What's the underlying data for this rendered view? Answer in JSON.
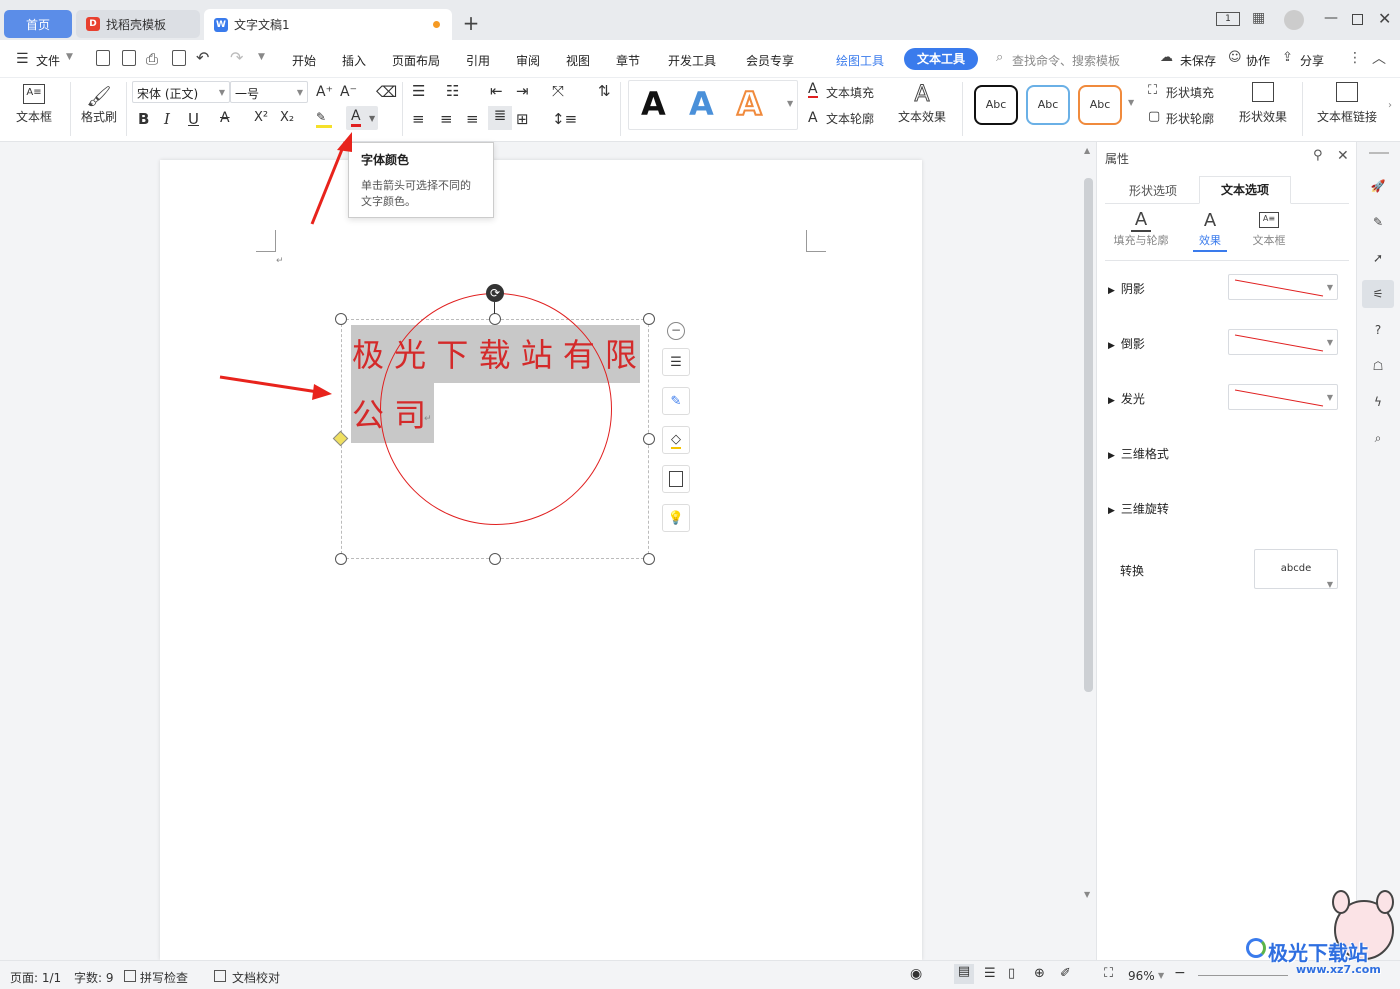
{
  "tabs": {
    "home": "首页",
    "templates": "找稻壳模板",
    "doc": "文字文稿1"
  },
  "menu": {
    "file": "文件",
    "start": "开始",
    "insert": "插入",
    "layout": "页面布局",
    "reference": "引用",
    "review": "审阅",
    "view": "视图",
    "chapter": "章节",
    "devtools": "开发工具",
    "member": "会员专享",
    "drawtools": "绘图工具",
    "texttools": "文本工具",
    "search": "查找命令、搜索模板",
    "unsaved": "未保存",
    "collab": "协作",
    "share": "分享"
  },
  "ribbon": {
    "textbox": "文本框",
    "format_painter": "格式刷",
    "font": "宋体 (正文)",
    "size": "一号",
    "text_fill": "文本填充",
    "text_outline": "文本轮廓",
    "text_effect": "文本效果",
    "shape_fill": "形状填充",
    "shape_outline": "形状轮廓",
    "shape_effect": "形状效果",
    "textbox_link": "文本框链接",
    "style_abc": "Abc",
    "big_a": "A"
  },
  "tooltip": {
    "title": "字体颜色",
    "body1": "单击箭头可选择不同的",
    "body2": "文字颜色。"
  },
  "doc": {
    "line1": "极 光 下 载 站 有 限",
    "line2": "公 司"
  },
  "panel": {
    "title": "属性",
    "tab_shape": "形状选项",
    "tab_text": "文本选项",
    "sub_fill": "填充与轮廓",
    "sub_effect": "效果",
    "sub_box": "文本框",
    "shadow": "阴影",
    "reflection": "倒影",
    "glow": "发光",
    "format3d": "三维格式",
    "rotate3d": "三维旋转",
    "transform": "转换",
    "transform_val": "abcde"
  },
  "status": {
    "page": "页面: 1/1",
    "words": "字数: 9",
    "spell": "拼写检查",
    "proof": "文档校对",
    "zoom": "96%"
  },
  "watermark": {
    "name": "极光下载站",
    "url": "www.xz7.com"
  },
  "colors": {
    "accent": "#5b8de8",
    "red": "#e02020"
  }
}
